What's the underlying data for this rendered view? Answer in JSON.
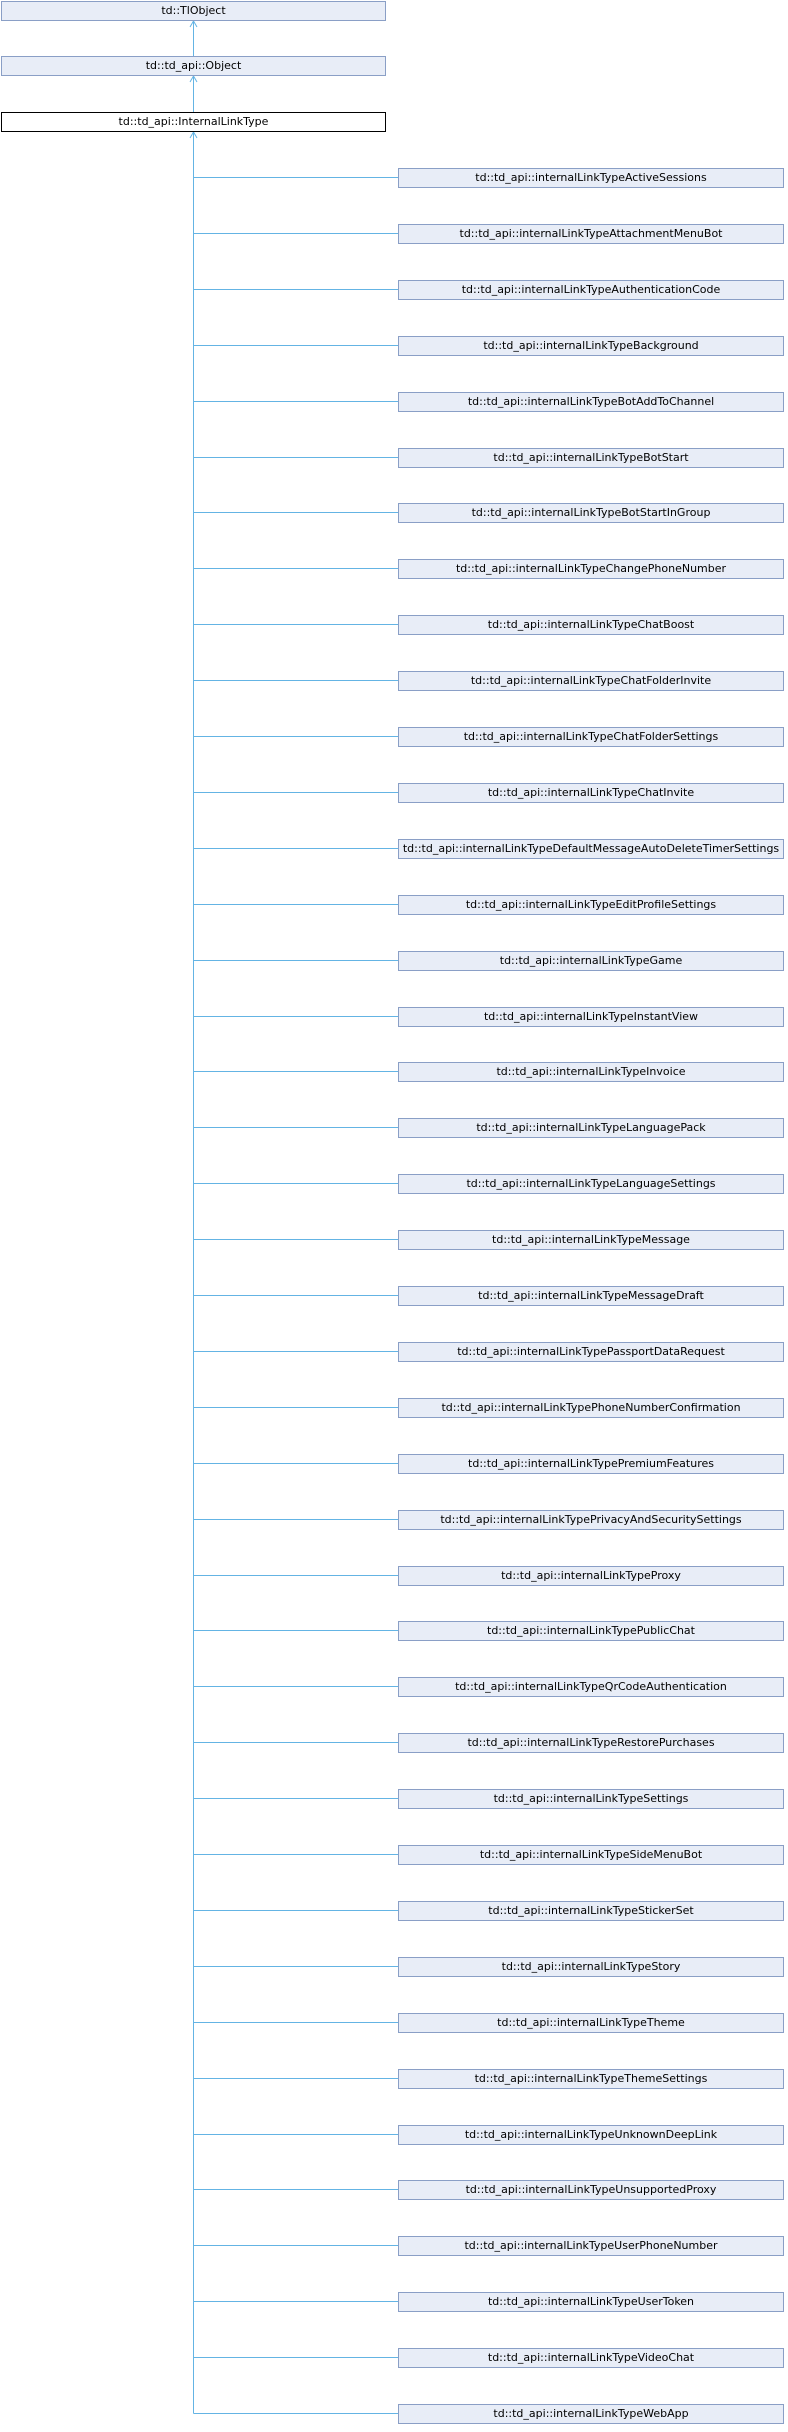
{
  "diagram": {
    "type": "class-inheritance",
    "ancestors": [
      "td::TlObject",
      "td::td_api::Object"
    ],
    "current": "td::td_api::InternalLinkType",
    "children": [
      "td::td_api::internalLinkTypeActiveSessions",
      "td::td_api::internalLinkTypeAttachmentMenuBot",
      "td::td_api::internalLinkTypeAuthenticationCode",
      "td::td_api::internalLinkTypeBackground",
      "td::td_api::internalLinkTypeBotAddToChannel",
      "td::td_api::internalLinkTypeBotStart",
      "td::td_api::internalLinkTypeBotStartInGroup",
      "td::td_api::internalLinkTypeChangePhoneNumber",
      "td::td_api::internalLinkTypeChatBoost",
      "td::td_api::internalLinkTypeChatFolderInvite",
      "td::td_api::internalLinkTypeChatFolderSettings",
      "td::td_api::internalLinkTypeChatInvite",
      "td::td_api::internalLinkTypeDefaultMessageAutoDeleteTimerSettings",
      "td::td_api::internalLinkTypeEditProfileSettings",
      "td::td_api::internalLinkTypeGame",
      "td::td_api::internalLinkTypeInstantView",
      "td::td_api::internalLinkTypeInvoice",
      "td::td_api::internalLinkTypeLanguagePack",
      "td::td_api::internalLinkTypeLanguageSettings",
      "td::td_api::internalLinkTypeMessage",
      "td::td_api::internalLinkTypeMessageDraft",
      "td::td_api::internalLinkTypePassportDataRequest",
      "td::td_api::internalLinkTypePhoneNumberConfirmation",
      "td::td_api::internalLinkTypePremiumFeatures",
      "td::td_api::internalLinkTypePrivacyAndSecuritySettings",
      "td::td_api::internalLinkTypeProxy",
      "td::td_api::internalLinkTypePublicChat",
      "td::td_api::internalLinkTypeQrCodeAuthentication",
      "td::td_api::internalLinkTypeRestorePurchases",
      "td::td_api::internalLinkTypeSettings",
      "td::td_api::internalLinkTypeSideMenuBot",
      "td::td_api::internalLinkTypeStickerSet",
      "td::td_api::internalLinkTypeStory",
      "td::td_api::internalLinkTypeTheme",
      "td::td_api::internalLinkTypeThemeSettings",
      "td::td_api::internalLinkTypeUnknownDeepLink",
      "td::td_api::internalLinkTypeUnsupportedProxy",
      "td::td_api::internalLinkTypeUserPhoneNumber",
      "td::td_api::internalLinkTypeUserToken",
      "td::td_api::internalLinkTypeVideoChat",
      "td::td_api::internalLinkTypeWebApp"
    ],
    "colors": {
      "node_fill": "#e8edf7",
      "node_border": "#8a9fc6",
      "current_border": "#000000",
      "edge": "#64b4e4"
    }
  }
}
